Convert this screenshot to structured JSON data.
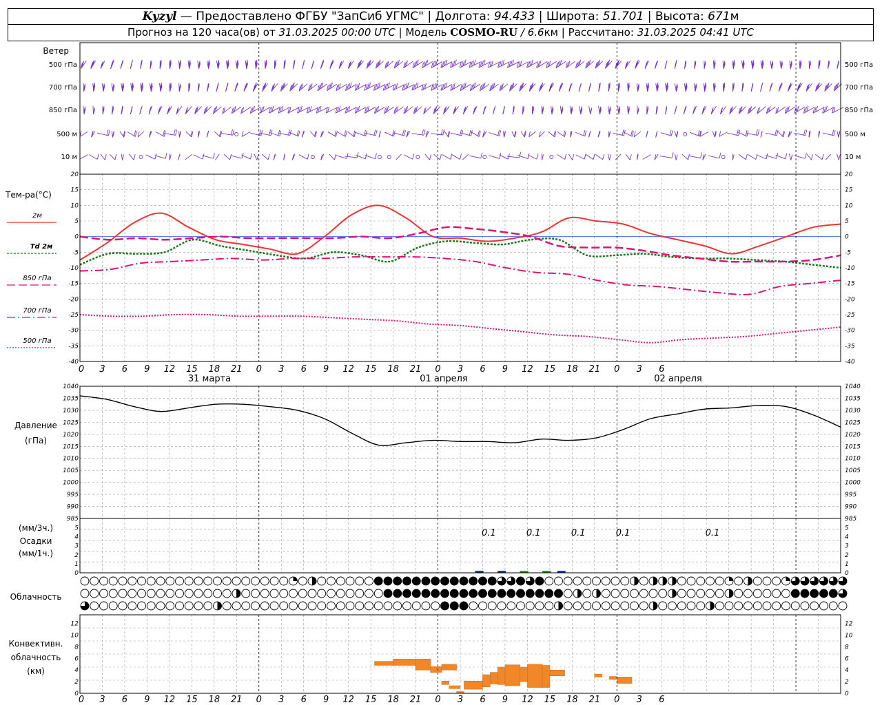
{
  "header": {
    "station": "Kyzyl",
    "provided_by": "— Предоставлено ФГБУ \"ЗапСиб УГМС\" |",
    "lon_label": "Долгота:",
    "lon_value": "94.433",
    "lat_label": "| Широта:",
    "lat_value": "51.701",
    "alt_label": "| Высота:",
    "alt_value": "671",
    "alt_unit": "м",
    "forecast_text": "Прогноз на 120 часа(ов) от",
    "forecast_start": "31.03.2025 00:00 UTC",
    "model_label": "| Модель",
    "model_name": "COSMO-RU",
    "model_res": "/ 6.6",
    "model_res_unit": "км",
    "calc_label": "| Рассчитано:",
    "calc_time": "31.03.2025 04:41 UTC"
  },
  "wind_panel": {
    "title": "Ветер",
    "levels": [
      "500 гПа",
      "700 гПа",
      "850 гПа",
      "500 м",
      "10  м"
    ]
  },
  "temp_panel": {
    "title": "Тем-ра(°C)",
    "legend": [
      {
        "label": "2м",
        "color": "#ee3333",
        "dash": ""
      },
      {
        "label": "Td  2м",
        "color": "#1a7a1a",
        "dash": "3,2"
      },
      {
        "label": "850 гПа",
        "color": "#dd1177",
        "dash": "12,5"
      },
      {
        "label": "700 гПа",
        "color": "#dd1177",
        "dash": "12,4,2,4"
      },
      {
        "label": "500 гПа",
        "color": "#dd1177",
        "dash": "2,2"
      }
    ],
    "y_ticks": [
      "20",
      "15",
      "10",
      "5",
      "0",
      "-5",
      "-10",
      "-15",
      "-20",
      "-25",
      "-30",
      "-35",
      "-40"
    ]
  },
  "x_axis": {
    "hour_labels": [
      "0",
      "3",
      "6",
      "9",
      "12",
      "15",
      "18",
      "21",
      "0",
      "3",
      "6",
      "9",
      "12",
      "15",
      "18",
      "21",
      "0",
      "3",
      "6",
      "9",
      "12",
      "15",
      "18",
      "21",
      "0",
      "3",
      "6"
    ],
    "day_labels": [
      "31 марта",
      "01 апреля",
      "02 апреля"
    ]
  },
  "pressure_panel": {
    "title": "Давление",
    "unit": "(гПа)",
    "y_ticks": [
      "1040",
      "1035",
      "1030",
      "1025",
      "1020",
      "1015",
      "1010",
      "1005",
      "1000",
      "995",
      "990",
      "985"
    ]
  },
  "precip_panel": {
    "unit3": "(мм/3ч.)",
    "title": "Осадки",
    "unit1": "(мм/1ч.)",
    "y_ticks": [
      "5",
      "4",
      "3",
      "2",
      "1",
      "0"
    ],
    "annotations": [
      {
        "text": "0.1",
        "hour": 55
      },
      {
        "text": "0.1",
        "hour": 61
      },
      {
        "text": "0.1",
        "hour": 67
      },
      {
        "text": "0.1",
        "hour": 73
      },
      {
        "text": "0.1",
        "hour": 85
      }
    ]
  },
  "cloud_panel": {
    "title": "Облачность"
  },
  "conv_panel": {
    "title1": "Конвективн.",
    "title2": "облачность",
    "unit": "(км)",
    "y_ticks": [
      "12",
      "10",
      "8",
      "6",
      "4",
      "2",
      "0"
    ]
  },
  "chart_data": [
    {
      "type": "line",
      "name": "temperature",
      "xlabel": "",
      "ylabel": "Тем-ра(°C)",
      "x_hours": [
        0,
        3,
        6,
        9,
        12,
        15,
        18,
        21,
        24,
        27,
        30,
        33,
        36,
        39,
        42,
        45,
        48,
        51,
        54,
        57,
        60,
        63,
        66,
        69,
        72,
        75,
        78,
        81,
        84,
        87,
        90,
        93,
        96,
        99,
        102
      ],
      "ylim": [
        -40,
        20
      ],
      "series": [
        {
          "name": "2м",
          "values": [
            -7.5,
            -2,
            4.5,
            7.5,
            3,
            -1,
            -2.5,
            -4,
            -5.5,
            0,
            7,
            10,
            6,
            0,
            -0.5,
            -1.5,
            -0.5,
            1.5,
            6,
            5,
            4,
            1,
            -1,
            -3,
            -5.5,
            -3,
            0,
            3,
            4
          ]
        },
        {
          "name": "Td  2м",
          "values": [
            -9,
            -5.5,
            -5.5,
            -5,
            -1,
            -3,
            -4.5,
            -6,
            -7,
            -5,
            -6,
            -8,
            -3.5,
            -1.5,
            -2,
            -2.5,
            -1,
            -1,
            -6,
            -6,
            -5.5,
            -6.5,
            -7,
            -7,
            -7.5,
            -8,
            -9,
            -10
          ]
        },
        {
          "name": "850 гПа",
          "values": [
            0,
            -1,
            -0.5,
            -1,
            -0.5,
            0,
            -0.5,
            -0.5,
            -0.5,
            -0.5,
            0,
            -0.5,
            1,
            3,
            2.5,
            1.5,
            0,
            -3,
            -3.5,
            -3.5,
            -4.5,
            -6,
            -7,
            -8,
            -8,
            -8,
            -7.5,
            -6
          ]
        },
        {
          "name": "700 гПа",
          "values": [
            -11,
            -10.5,
            -8.5,
            -8,
            -7.5,
            -7,
            -7.5,
            -7,
            -7,
            -6.5,
            -6.5,
            -6.5,
            -7,
            -8,
            -10,
            -11.5,
            -12,
            -14,
            -15.5,
            -16,
            -17,
            -18,
            -18.5,
            -16,
            -15,
            -14
          ]
        },
        {
          "name": "500 гПа",
          "values": [
            -25,
            -25.5,
            -25.5,
            -25,
            -25,
            -25.5,
            -25.5,
            -25.5,
            -26,
            -26.5,
            -27,
            -28,
            -28.5,
            -29.5,
            -30.5,
            -31.5,
            -32,
            -33,
            -34,
            -33,
            -32.5,
            -32,
            -31,
            -30,
            -29
          ]
        }
      ]
    },
    {
      "type": "line",
      "name": "pressure",
      "xlabel": "",
      "ylabel": "Давление",
      "x_hours": [
        0,
        3,
        6,
        9,
        12,
        15,
        18,
        21,
        24,
        27,
        30,
        33,
        36,
        39,
        42,
        45,
        48,
        51,
        54,
        57,
        60,
        63,
        66,
        69,
        72,
        75,
        78,
        81,
        84,
        87,
        90,
        93,
        96,
        99,
        102
      ],
      "ylim": [
        985,
        1040
      ],
      "series": [
        {
          "name": "",
          "values": [
            1036,
            1034.5,
            1031.5,
            1029.5,
            1031,
            1032.5,
            1032.5,
            1031.5,
            1030,
            1026.5,
            1020.5,
            1015.5,
            1016.5,
            1017.5,
            1017,
            1017,
            1016.5,
            1018,
            1017.5,
            1018.5,
            1022,
            1026.5,
            1028.5,
            1030.5,
            1031,
            1032,
            1031.5,
            1028,
            1023
          ]
        }
      ]
    },
    {
      "type": "bar",
      "name": "convective_cloud",
      "xlabel": "",
      "ylabel": "Конвективн. облачность (км)",
      "ylim": [
        0,
        13
      ],
      "bars": [
        {
          "x0": 39.5,
          "x1": 42,
          "bottom": 4.8,
          "top": 5.5
        },
        {
          "x0": 42,
          "x1": 45,
          "bottom": 4.8,
          "top": 5.9
        },
        {
          "x0": 45,
          "x1": 47,
          "bottom": 4.0,
          "top": 5.9
        },
        {
          "x0": 47,
          "x1": 48.5,
          "bottom": 3.6,
          "top": 4.6
        },
        {
          "x0": 48.5,
          "x1": 50.5,
          "bottom": 4.0,
          "top": 5.0
        },
        {
          "x0": 48.5,
          "x1": 49.5,
          "bottom": 1.5,
          "top": 2.1
        },
        {
          "x0": 49.5,
          "x1": 51,
          "bottom": 0.8,
          "top": 1.3
        },
        {
          "x0": 50.5,
          "x1": 51.5,
          "bottom": 0.1,
          "top": 0.3
        },
        {
          "x0": 51.5,
          "x1": 54,
          "bottom": 0.7,
          "top": 2.1
        },
        {
          "x0": 54,
          "x1": 55,
          "bottom": 1.1,
          "top": 3.2
        },
        {
          "x0": 55,
          "x1": 56,
          "bottom": 1.6,
          "top": 3.6
        },
        {
          "x0": 56,
          "x1": 57,
          "bottom": 1.5,
          "top": 4.5
        },
        {
          "x0": 57,
          "x1": 59,
          "bottom": 1.3,
          "top": 4.9
        },
        {
          "x0": 59,
          "x1": 60,
          "bottom": 2.0,
          "top": 4.5
        },
        {
          "x0": 60,
          "x1": 62,
          "bottom": 1.0,
          "top": 5.0
        },
        {
          "x0": 62,
          "x1": 63,
          "bottom": 1.0,
          "top": 4.8
        },
        {
          "x0": 63,
          "x1": 65,
          "bottom": 3.0,
          "top": 4.0
        },
        {
          "x0": 69,
          "x1": 70,
          "bottom": 2.8,
          "top": 3.3
        },
        {
          "x0": 71,
          "x1": 72,
          "bottom": 2.4,
          "top": 2.9
        },
        {
          "x0": 72,
          "x1": 74,
          "bottom": 1.7,
          "top": 2.8
        }
      ]
    }
  ]
}
